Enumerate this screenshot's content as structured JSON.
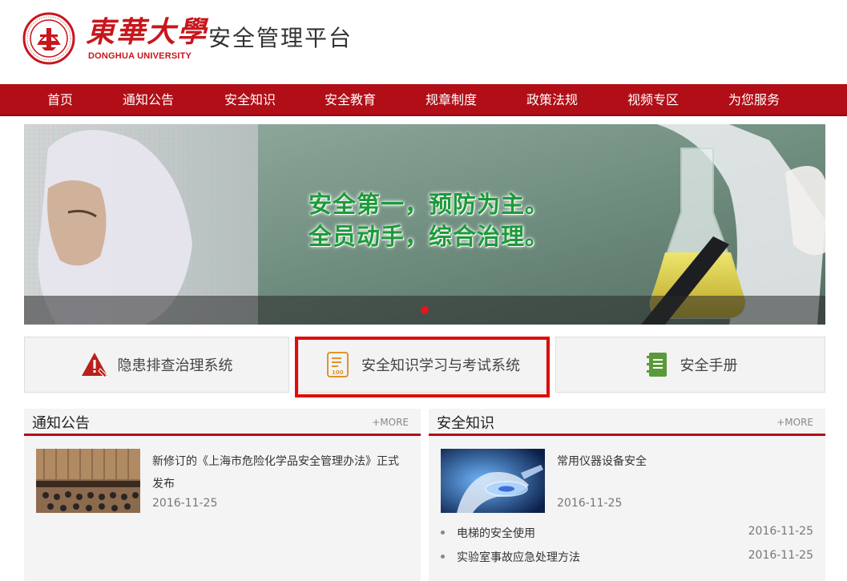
{
  "header": {
    "logo_cn": "東華大學",
    "logo_en": "DONGHUA UNIVERSITY",
    "site_title": "安全管理平台",
    "accent": "#b10e17"
  },
  "nav": {
    "items": [
      "首页",
      "通知公告",
      "安全知识",
      "安全教育",
      "规章制度",
      "政策法规",
      "视频专区",
      "为您服务"
    ]
  },
  "banner": {
    "slogan_line1": "安全第一，预防为主。",
    "slogan_line2": "全员动手，综合治理。",
    "active_slide": 1
  },
  "systems": [
    {
      "label": "隐患排查治理系统",
      "icon": "warning-wrench-icon"
    },
    {
      "label": "安全知识学习与考试系统",
      "icon": "exam-document-icon"
    },
    {
      "label": "安全手册",
      "icon": "handbook-icon"
    }
  ],
  "notice_panel": {
    "title": "通知公告",
    "more": "+MORE",
    "featured": {
      "title": "新修订的《上海市危险化学品安全管理办法》正式发布",
      "date": "2016-11-25"
    }
  },
  "knowledge_panel": {
    "title": "安全知识",
    "more": "+MORE",
    "featured": {
      "title": "常用仪器设备安全",
      "date": "2016-11-25"
    },
    "items": [
      {
        "title": "电梯的安全使用",
        "date": "2016-11-25"
      },
      {
        "title": "实验室事故应急处理方法",
        "date": "2016-11-25"
      }
    ]
  }
}
